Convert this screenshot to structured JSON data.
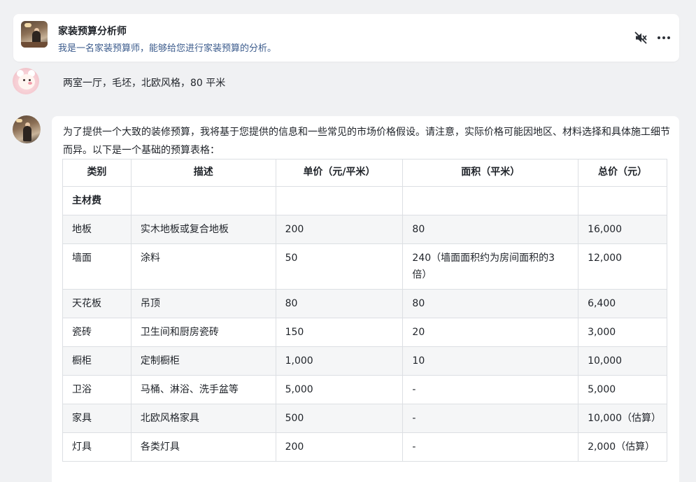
{
  "header": {
    "title": "家装预算分析师",
    "description": "我是一名家装预算师，能够给您进行家装预算的分析。",
    "mute_icon": "speaker-muted-icon",
    "more_icon": "more-horizontal-icon"
  },
  "user_message": {
    "text": "两室一厅，毛坯，北欧风格，80 平米"
  },
  "bot_message": {
    "intro": "为了提供一个大致的装修预算，我将基于您提供的信息和一些常见的市场价格假设。请注意，实际价格可能因地区、材料选择和具体施工细节而异。以下是一个基础的预算表格：",
    "table": {
      "headers": [
        "类别",
        "描述",
        "单价（元/平米）",
        "面积（平米）",
        "总价（元）"
      ],
      "section_label": "主材费",
      "rows": [
        [
          "地板",
          "实木地板或复合地板",
          "200",
          "80",
          "16,000"
        ],
        [
          "墙面",
          "涂料",
          "50",
          "240（墙面面积约为房间面积的3倍）",
          "12,000"
        ],
        [
          "天花板",
          "吊顶",
          "80",
          "80",
          "6,400"
        ],
        [
          "瓷砖",
          "卫生间和厨房瓷砖",
          "150",
          "20",
          "3,000"
        ],
        [
          "橱柜",
          "定制橱柜",
          "1,000",
          "10",
          "10,000"
        ],
        [
          "卫浴",
          "马桶、淋浴、洗手盆等",
          "5,000",
          "-",
          "5,000"
        ],
        [
          "家具",
          "北欧风格家具",
          "500",
          "-",
          "10,000（估算）"
        ],
        [
          "灯具",
          "各类灯具",
          "200",
          "-",
          "2,000（估算）"
        ]
      ]
    }
  },
  "colors": {
    "background": "#f0f1f3",
    "card": "#ffffff",
    "description_text": "#3b5b8c",
    "table_border": "#dcdfe3",
    "zebra_row": "#f5f6f7"
  }
}
